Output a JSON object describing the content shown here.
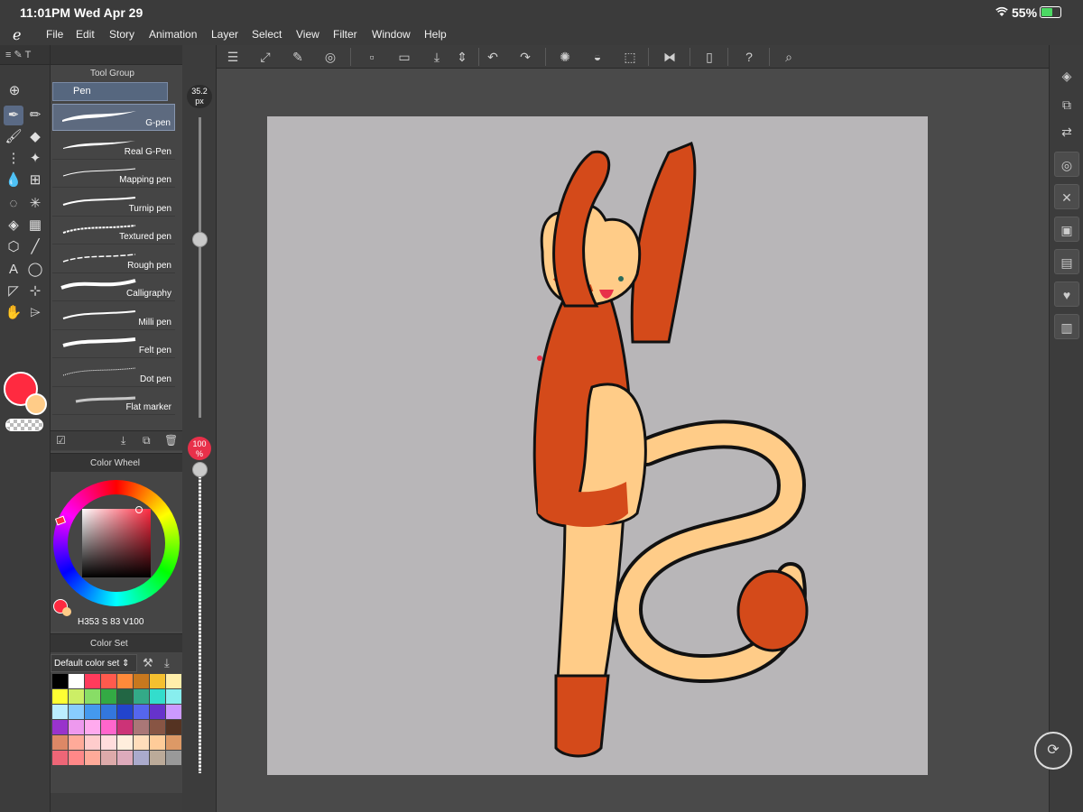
{
  "status": {
    "time": "11:01PM",
    "date": "Wed Apr 29",
    "battery": "55%"
  },
  "menu": [
    "File",
    "Edit",
    "Story",
    "Animation",
    "Layer",
    "Select",
    "View",
    "Filter",
    "Window",
    "Help"
  ],
  "tool_panel": {
    "tab_label": "Tool Group",
    "sub_tool": "Pen",
    "tool_strip_tab": "T"
  },
  "brushes": [
    "G-pen",
    "Real G-Pen",
    "Mapping pen",
    "Turnip pen",
    "Textured pen",
    "Rough pen",
    "Calligraphy",
    "Milli pen",
    "Felt pen",
    "Dot pen",
    "Flat marker"
  ],
  "brush_size": {
    "value": "35.2",
    "unit": "px"
  },
  "opacity": {
    "value": "100",
    "unit": "%"
  },
  "color_wheel": {
    "title": "Color Wheel",
    "h_label": "H",
    "h": "353",
    "s_label": "S",
    "s": "83",
    "v_label": "V",
    "v": "100",
    "main_color": "#ff2a40",
    "sub_color": "#ffcc88"
  },
  "color_set": {
    "title": "Color Set",
    "set_name": "Default color set",
    "swatches": [
      "#000000",
      "#ffffff",
      "#ff3b5c",
      "#ff5a4d",
      "#ff8a3a",
      "#c8781e",
      "#f5c030",
      "#ffeeaa",
      "#ffff33",
      "#ccee66",
      "#88dd66",
      "#33aa44",
      "#226644",
      "#33aa88",
      "#33ddcc",
      "#88eeee",
      "#bbeeff",
      "#88ccff",
      "#4499ee",
      "#3377dd",
      "#2244cc",
      "#5566ee",
      "#6633cc",
      "#cc99ff",
      "#9933cc",
      "#ee99ee",
      "#ffaaee",
      "#ff66cc",
      "#cc3377",
      "#aa7777",
      "#885544",
      "#553322",
      "#dd8866",
      "#ffaa99",
      "#ffcccc",
      "#ffdddd",
      "#ffeedd",
      "#ffddbb",
      "#ffcc99",
      "#dd9966",
      "#ee6677",
      "#ff8888",
      "#ffaa99",
      "#ddaaaa",
      "#ddaabb",
      "#aaaacc",
      "#bbaa99",
      "#999999"
    ]
  }
}
